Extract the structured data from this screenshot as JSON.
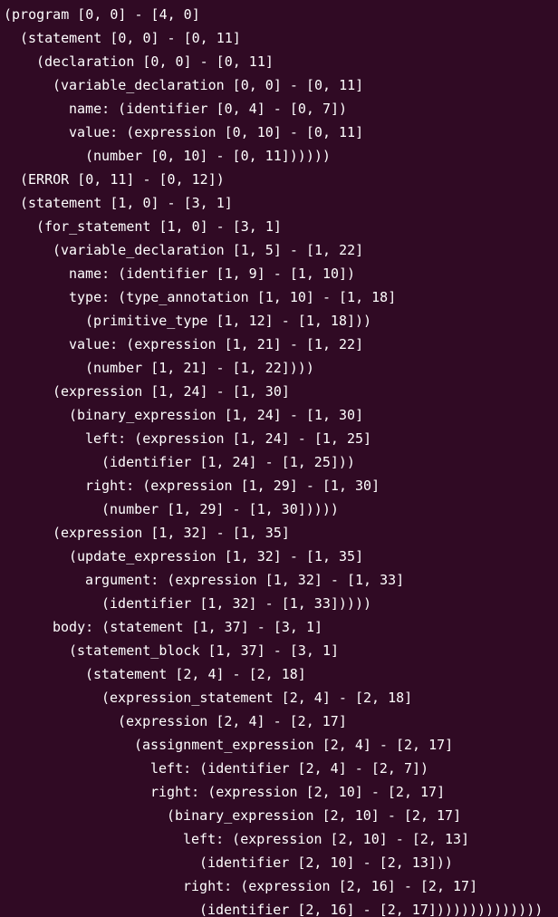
{
  "terminal": {
    "background": "#300a24",
    "foreground": "#ffffff",
    "lines": [
      {
        "indent": 0,
        "text": "(program [0, 0] - [4, 0]"
      },
      {
        "indent": 1,
        "text": "(statement [0, 0] - [0, 11]"
      },
      {
        "indent": 2,
        "text": "(declaration [0, 0] - [0, 11]"
      },
      {
        "indent": 3,
        "text": "(variable_declaration [0, 0] - [0, 11]"
      },
      {
        "indent": 4,
        "text": "name: (identifier [0, 4] - [0, 7])"
      },
      {
        "indent": 4,
        "text": "value: (expression [0, 10] - [0, 11]"
      },
      {
        "indent": 5,
        "text": "(number [0, 10] - [0, 11])))))"
      },
      {
        "indent": 1,
        "text": "(ERROR [0, 11] - [0, 12])"
      },
      {
        "indent": 1,
        "text": "(statement [1, 0] - [3, 1]"
      },
      {
        "indent": 2,
        "text": "(for_statement [1, 0] - [3, 1]"
      },
      {
        "indent": 3,
        "text": "(variable_declaration [1, 5] - [1, 22]"
      },
      {
        "indent": 4,
        "text": "name: (identifier [1, 9] - [1, 10])"
      },
      {
        "indent": 4,
        "text": "type: (type_annotation [1, 10] - [1, 18]"
      },
      {
        "indent": 5,
        "text": "(primitive_type [1, 12] - [1, 18]))"
      },
      {
        "indent": 4,
        "text": "value: (expression [1, 21] - [1, 22]"
      },
      {
        "indent": 5,
        "text": "(number [1, 21] - [1, 22])))"
      },
      {
        "indent": 3,
        "text": "(expression [1, 24] - [1, 30]"
      },
      {
        "indent": 4,
        "text": "(binary_expression [1, 24] - [1, 30]"
      },
      {
        "indent": 5,
        "text": "left: (expression [1, 24] - [1, 25]"
      },
      {
        "indent": 6,
        "text": "(identifier [1, 24] - [1, 25]))"
      },
      {
        "indent": 5,
        "text": "right: (expression [1, 29] - [1, 30]"
      },
      {
        "indent": 6,
        "text": "(number [1, 29] - [1, 30]))))"
      },
      {
        "indent": 3,
        "text": "(expression [1, 32] - [1, 35]"
      },
      {
        "indent": 4,
        "text": "(update_expression [1, 32] - [1, 35]"
      },
      {
        "indent": 5,
        "text": "argument: (expression [1, 32] - [1, 33]"
      },
      {
        "indent": 6,
        "text": "(identifier [1, 32] - [1, 33]))))"
      },
      {
        "indent": 3,
        "text": "body: (statement [1, 37] - [3, 1]"
      },
      {
        "indent": 4,
        "text": "(statement_block [1, 37] - [3, 1]"
      },
      {
        "indent": 5,
        "text": "(statement [2, 4] - [2, 18]"
      },
      {
        "indent": 6,
        "text": "(expression_statement [2, 4] - [2, 18]"
      },
      {
        "indent": 7,
        "text": "(expression [2, 4] - [2, 17]"
      },
      {
        "indent": 8,
        "text": "(assignment_expression [2, 4] - [2, 17]"
      },
      {
        "indent": 9,
        "text": "left: (identifier [2, 4] - [2, 7])"
      },
      {
        "indent": 9,
        "text": "right: (expression [2, 10] - [2, 17]"
      },
      {
        "indent": 10,
        "text": "(binary_expression [2, 10] - [2, 17]"
      },
      {
        "indent": 11,
        "text": "left: (expression [2, 10] - [2, 13]"
      },
      {
        "indent": 12,
        "text": "(identifier [2, 10] - [2, 13]))"
      },
      {
        "indent": 11,
        "text": "right: (expression [2, 16] - [2, 17]"
      },
      {
        "indent": 12,
        "text": "(identifier [2, 16] - [2, 17])))))))))))))"
      }
    ]
  }
}
